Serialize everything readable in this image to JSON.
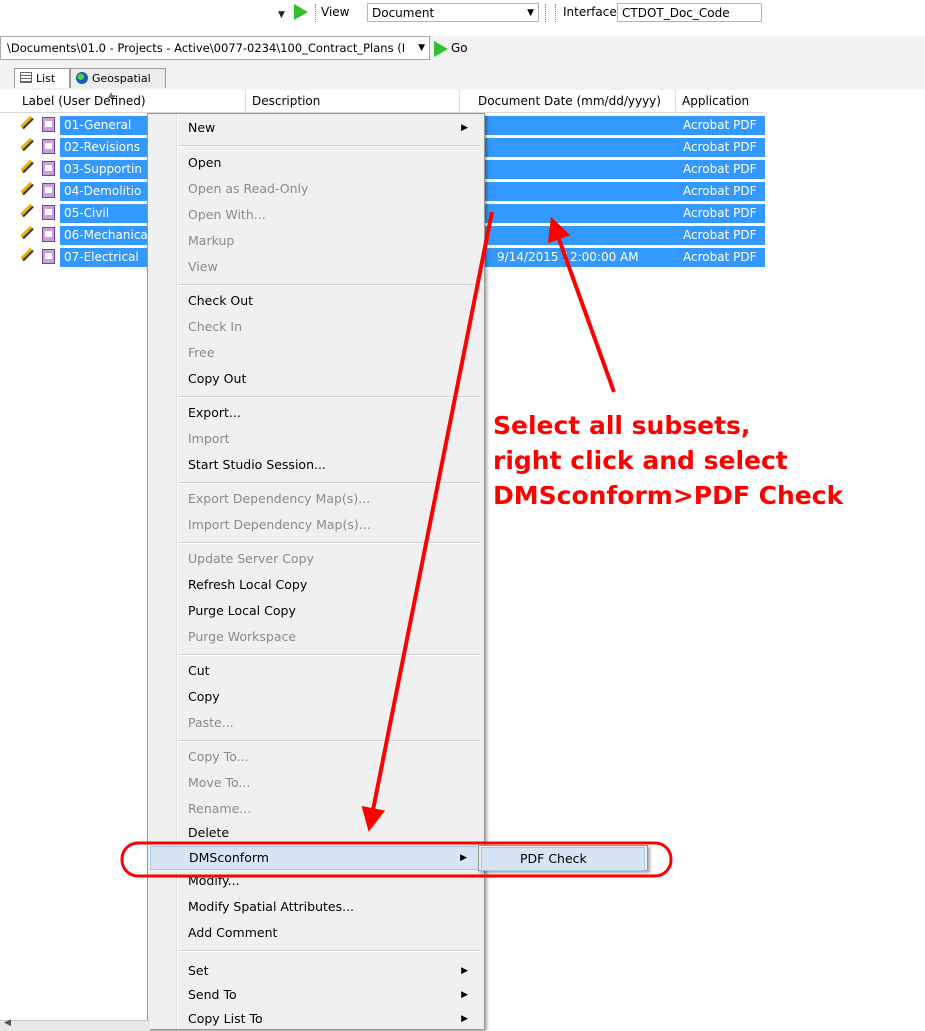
{
  "toolbar": {
    "view_label": "View",
    "view_value": "Document",
    "interface_label": "Interface",
    "interface_value": "CTDOT_Doc_Code"
  },
  "pathbar": {
    "path": "\\Documents\\01.0 - Projects - Active\\0077-0234\\100_Contract_Plans (I",
    "go_label": "Go"
  },
  "tabs": [
    {
      "label": "List",
      "icon": "list-icon"
    },
    {
      "label": "Geospatial",
      "icon": "globe-icon"
    }
  ],
  "columns": [
    "Label (User Defined)",
    "Description",
    "Document Date (mm/dd/yyyy)",
    "Application"
  ],
  "rows": [
    {
      "label": "01-General",
      "date": "",
      "app": "Acrobat PDF"
    },
    {
      "label": "02-Revisions",
      "date": "",
      "app": "Acrobat PDF"
    },
    {
      "label": "03-Supportin",
      "date": "",
      "app": "Acrobat PDF"
    },
    {
      "label": "04-Demolitio",
      "date": "",
      "app": "Acrobat PDF"
    },
    {
      "label": "05-Civil",
      "date": "",
      "app": "Acrobat PDF"
    },
    {
      "label": "06-Mechanica",
      "date": "",
      "app": "Acrobat PDF"
    },
    {
      "label": "07-Electrical",
      "date": "9/14/2015 12:00:00 AM",
      "app": "Acrobat PDF"
    }
  ],
  "menu": {
    "new": "New",
    "open": "Open",
    "open_readonly": "Open as Read-Only",
    "open_with": "Open With...",
    "markup": "Markup",
    "view": "View",
    "check_out": "Check Out",
    "check_in": "Check In",
    "free": "Free",
    "copy_out": "Copy Out",
    "export": "Export...",
    "import": "Import",
    "start_studio": "Start Studio Session...",
    "export_dep": "Export Dependency Map(s)...",
    "import_dep": "Import Dependency Map(s)...",
    "update_server": "Update Server Copy",
    "refresh_local": "Refresh Local Copy",
    "purge_local": "Purge Local Copy",
    "purge_workspace": "Purge Workspace",
    "cut": "Cut",
    "copy": "Copy",
    "paste": "Paste...",
    "copy_to": "Copy To...",
    "move_to": "Move To...",
    "rename": "Rename...",
    "delete": "Delete",
    "dmsconform": "DMSconform",
    "modify": "Modify...",
    "modify_spatial": "Modify Spatial Attributes...",
    "add_comment": "Add Comment",
    "set": "Set",
    "send_to": "Send To",
    "copy_list_to": "Copy List To"
  },
  "submenu": {
    "pdf_check": "PDF Check"
  },
  "annotation": {
    "line1": "Select all subsets,",
    "line2": "right click and select",
    "line3": "DMSconform>PDF Check"
  },
  "colors": {
    "selection": "#3399ff",
    "annotation": "#ff0000",
    "go_arrow": "#2fbf2f"
  }
}
